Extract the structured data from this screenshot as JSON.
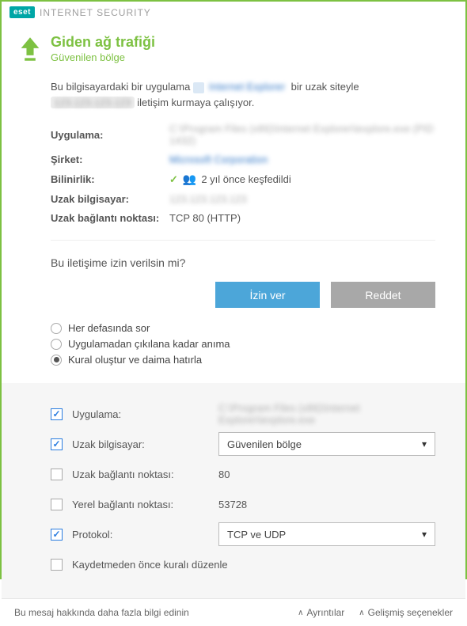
{
  "titlebar": {
    "logo": "eset",
    "product": "INTERNET SECURITY"
  },
  "header": {
    "title": "Giden ağ trafiği",
    "subtitle": "Güvenilen bölge"
  },
  "intro": {
    "prefix": "Bu bilgisayardaki bir uygulama ",
    "app_blur": "Internet Explorer",
    "mid": " bir uzak siteyle ",
    "host_blur": "123.123.123.123",
    "suffix": " iletişim kurmaya çalışıyor."
  },
  "details": {
    "app_label": "Uygulama:",
    "app_value": "C:\\Program Files (x86)\\Internet Explorer\\iexplore.exe (PID 1432)",
    "company_label": "Şirket:",
    "company_value": "Microsoft Corporation",
    "reputation_label": "Bilinirlik:",
    "reputation_value": "2 yıl önce keşfedildi",
    "remote_label": "Uzak bilgisayar:",
    "remote_value": "123.123.123.123",
    "port_label": "Uzak bağlantı noktası:",
    "port_value": "TCP 80 (HTTP)"
  },
  "question": "Bu iletişime izin verilsin mi?",
  "buttons": {
    "allow": "İzin ver",
    "deny": "Reddet"
  },
  "radios": {
    "ask": "Her defasında sor",
    "remember_until_exit": "Uygulamadan çıkılana kadar anıma",
    "create_rule": "Kural oluştur ve daima hatırla"
  },
  "rules": {
    "app_label": "Uygulama:",
    "app_value": "C:\\Program Files (x86)\\Internet Explorer\\iexplore.exe",
    "remote_label": "Uzak bilgisayar:",
    "remote_select": "Güvenilen bölge",
    "remote_port_label": "Uzak bağlantı noktası:",
    "remote_port_value": "80",
    "local_port_label": "Yerel bağlantı noktası:",
    "local_port_value": "53728",
    "protocol_label": "Protokol:",
    "protocol_select": "TCP ve UDP",
    "edit_label": "Kaydetmeden önce kuralı düzenle"
  },
  "footer": {
    "more_info": "Bu mesaj hakkında daha fazla bilgi edinin",
    "details": "Ayrıntılar",
    "advanced": "Gelişmiş seçenekler"
  }
}
